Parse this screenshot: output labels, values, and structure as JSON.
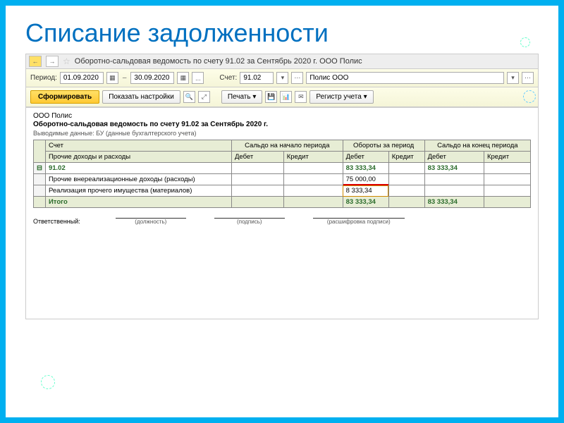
{
  "slide": {
    "title": "Списание задолженности"
  },
  "tabbar": {
    "title": "Оборотно-сальдовая ведомость по счету 91.02 за Сентябрь 2020 г. ООО Полис"
  },
  "period": {
    "label": "Период:",
    "from": "01.09.2020",
    "to": "30.09.2020",
    "dots": "...",
    "acct_label": "Счет:",
    "acct": "91.02",
    "org": "Полис ООО"
  },
  "toolbar": {
    "form": "Сформировать",
    "settings": "Показать настройки",
    "print": "Печать",
    "register": "Регистр учета"
  },
  "report": {
    "org": "ООО Полис",
    "title": "Оборотно-сальдовая ведомость по счету 91.02 за Сентябрь 2020 г.",
    "sub": "Выводимые данные: БУ (данные бухгалтерского учета)",
    "headers": {
      "acct": "Счет",
      "begin": "Сальдо на начало периода",
      "turnover": "Обороты за период",
      "end": "Сальдо на конец периода",
      "sub1": "Прочие доходы и расходы",
      "debit": "Дебет",
      "credit": "Кредит"
    },
    "rows": [
      {
        "name": "91.02",
        "t_debit": "83 333,34",
        "e_debit": "83 333,34",
        "cls": "acc"
      },
      {
        "name": "Прочие внереализационные доходы (расходы)",
        "t_debit": "75 000,00",
        "underline": true
      },
      {
        "name": "Реализация прочего имущества (материалов)",
        "t_debit": "8 333,34",
        "box": true
      }
    ],
    "total": {
      "label": "Итого",
      "t_debit": "83 333,34",
      "e_debit": "83 333,34"
    },
    "sign": {
      "resp": "Ответственный:",
      "pos": "(должность)",
      "sig": "(подпись)",
      "name": "(расшифровка подписи)"
    }
  }
}
